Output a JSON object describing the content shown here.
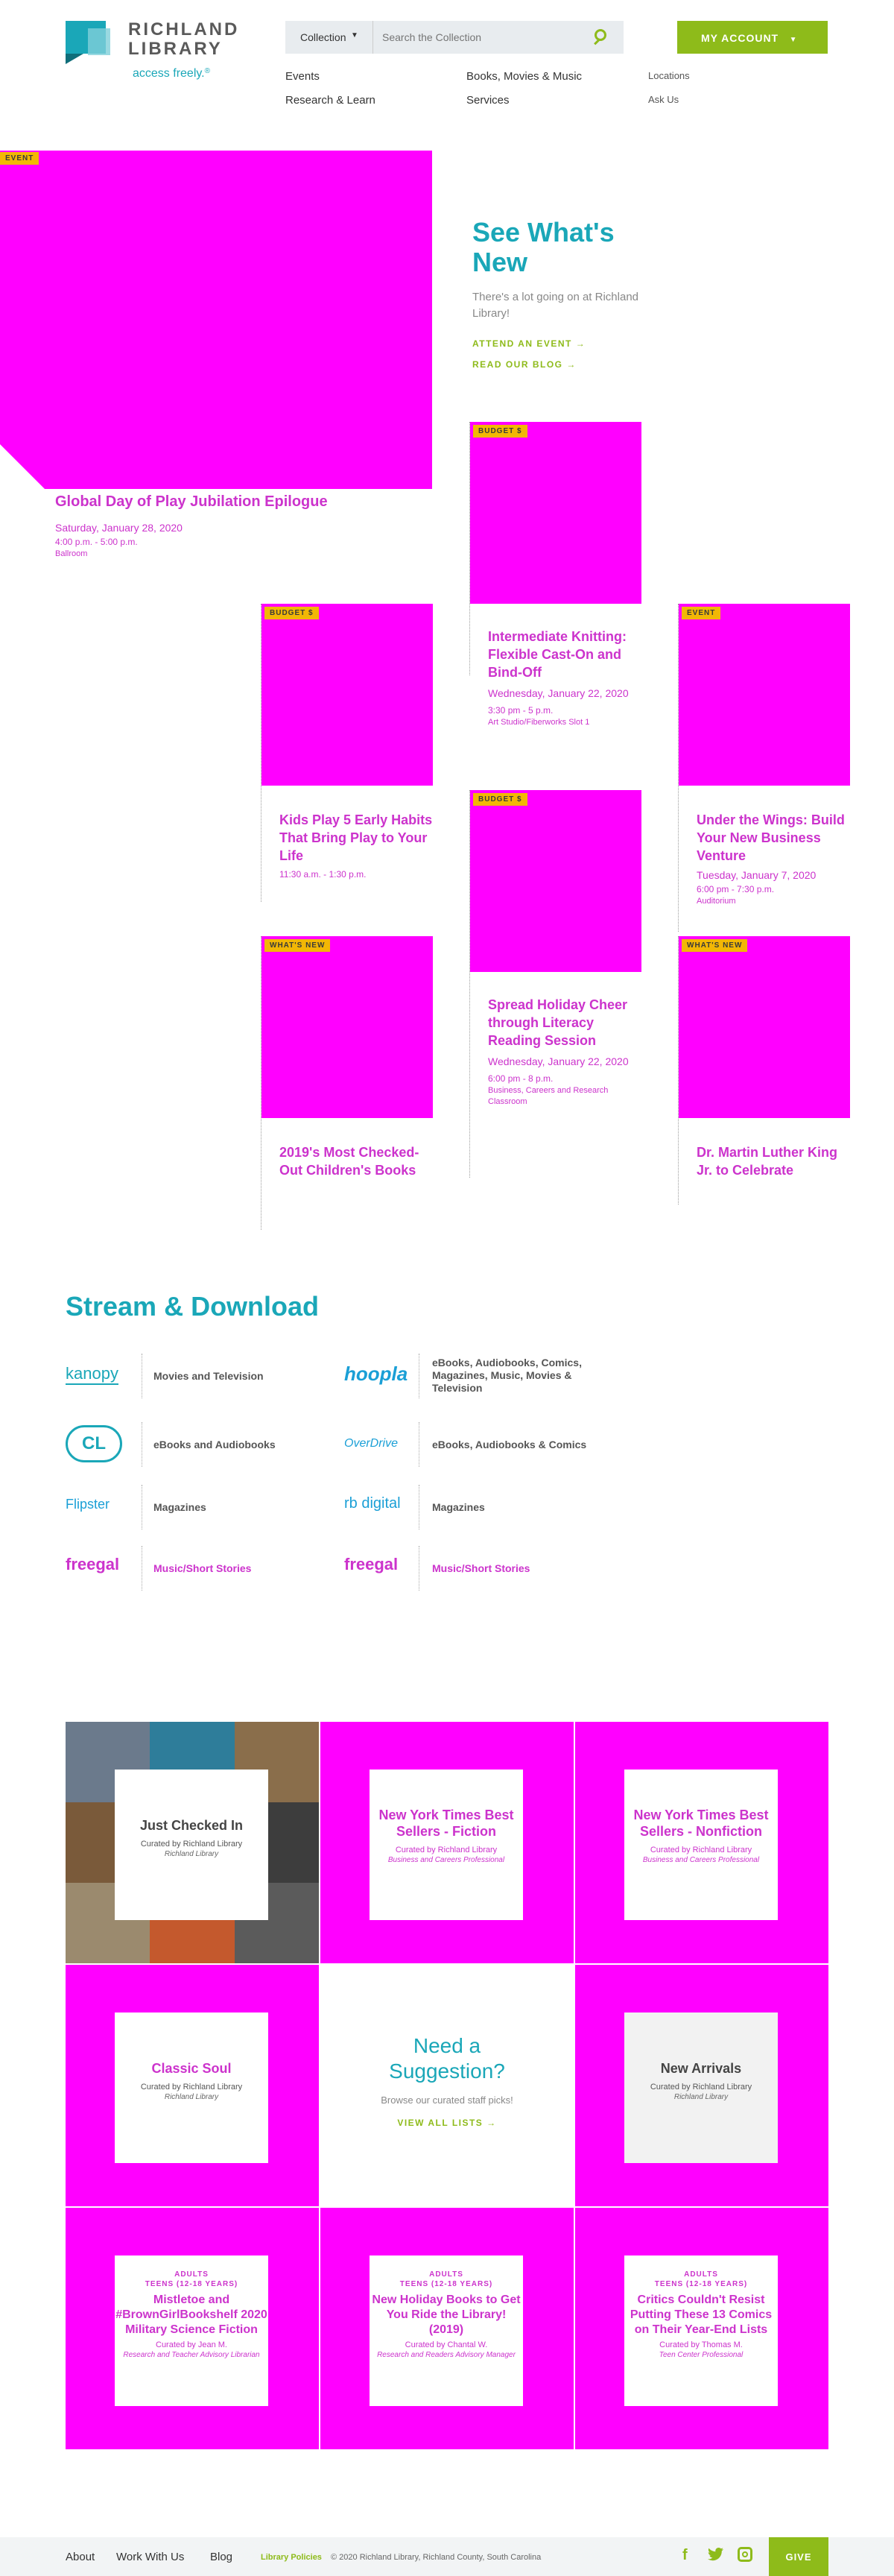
{
  "header": {
    "logo_line1": "RICHLAND",
    "logo_line2": "LIBRARY",
    "tagline": "access freely.",
    "tagline_mark": "®",
    "collection_label": "Collection",
    "search_placeholder": "Search the Collection",
    "account_label": "MY ACCOUNT",
    "nav_main": [
      "Events",
      "Books, Movies & Music",
      "Research & Learn",
      "Services"
    ],
    "nav_side": [
      "Locations",
      "Ask Us"
    ]
  },
  "hero": {
    "tag": "EVENT",
    "title": "See What's New",
    "subtitle": "There's a lot going on at Richland Library!",
    "link1": "ATTEND AN EVENT",
    "link2": "READ OUR BLOG",
    "featured_title": "Global Day of Play Jubilation Epilogue",
    "featured_date": "Saturday, January 28, 2020",
    "featured_time": "4:00 p.m. - 5:00 p.m.",
    "featured_loc": "Ballroom"
  },
  "cards": [
    {
      "tag": "BUDGET $",
      "title": "Intermediate Knitting: Flexible Cast-On and Bind-Off",
      "date": "Wednesday, January 22, 2020",
      "time": "3:30 pm - 5 p.m.",
      "loc": "Art Studio/Fiberworks Slot 1"
    },
    {
      "tag": "BUDGET $",
      "title": "Kids Play 5 Early Habits That Bring Play to Your Life",
      "date": "",
      "time": "11:30 a.m. - 1:30 p.m.",
      "loc": ""
    },
    {
      "tag": "EVENT",
      "title": "Under the Wings: Build Your New Business Venture",
      "date": "Tuesday, January 7, 2020",
      "time": "6:00 pm - 7:30 p.m.",
      "loc": "Auditorium"
    },
    {
      "tag": "BUDGET $",
      "title": "Spread Holiday Cheer through Literacy Reading Session",
      "date": "Wednesday, January 22, 2020",
      "time": "6:00 pm - 8 p.m.",
      "loc": "Business, Careers and Research Classroom"
    },
    {
      "tag": "WHAT'S NEW",
      "title": "2019's Most Checked-Out Children's Books",
      "date": "",
      "time": "",
      "loc": ""
    },
    {
      "tag": "WHAT'S NEW",
      "title": "Dr. Martin Luther King Jr. to Celebrate",
      "date": "",
      "time": "",
      "loc": ""
    }
  ],
  "stream": {
    "heading": "Stream & Download",
    "services": [
      {
        "logo": "kanopy",
        "label": "Movies and Television",
        "color": "#1aa7b8"
      },
      {
        "logo": "hoopla",
        "label": "eBooks, Audiobooks, Comics, Magazines, Music, Movies & Television",
        "color": "#1a9fd6"
      },
      {
        "logo": "CL",
        "label": "eBooks and Audiobooks",
        "color": "#1aa7b8"
      },
      {
        "logo": "OverDrive",
        "label": "eBooks, Audiobooks & Comics",
        "color": "#1a9fd6"
      },
      {
        "logo": "Flipster",
        "label": "Magazines",
        "color": "#1a9fd6"
      },
      {
        "logo": "rb digital",
        "label": "Magazines",
        "color": "#1a9fd6"
      },
      {
        "logo": "freegal",
        "label": "Music/Short Stories",
        "color": "#cc33cc"
      },
      {
        "logo": "freegal",
        "label": "Music/Short Stories",
        "color": "#cc33cc"
      }
    ]
  },
  "lists": {
    "just_checked_in": {
      "title": "Just Checked In",
      "sub": "Curated by Richland Library",
      "sub2": "Richland Library"
    },
    "nyt_fiction": {
      "title": "New York Times Best Sellers - Fiction",
      "sub": "Curated by Richland Library",
      "sub2": "Business and Careers Professional"
    },
    "nyt_nonfiction": {
      "title": "New York Times Best Sellers - Nonfiction",
      "sub": "Curated by Richland Library",
      "sub2": "Business and Careers Professional"
    },
    "music": {
      "title": "Classic Soul",
      "sub": "Curated by Richland Library",
      "sub2": "Richland Library"
    },
    "suggestion": {
      "title": "Need a Suggestion?",
      "sub": "Browse our curated staff picks!",
      "link": "VIEW ALL LISTS"
    },
    "new_arrivals": {
      "title": "New Arrivals",
      "sub": "Curated by Richland Library",
      "sub2": "Richland Library"
    },
    "bottom": [
      {
        "label": "ADULTS",
        "label2": "TEENS (12-18 YEARS)",
        "title": "Mistletoe and #BrownGirlBookshelf 2020 Military Science Fiction",
        "sub": "Curated by Jean M.",
        "sub2": "Research and Teacher Advisory Librarian"
      },
      {
        "label": "ADULTS",
        "label2": "TEENS (12-18 YEARS)",
        "title": "New Holiday Books to Get You Ride the Library! (2019)",
        "sub": "Curated by Chantal W.",
        "sub2": "Research and Readers Advisory Manager"
      },
      {
        "label": "ADULTS",
        "label2": "TEENS (12-18 YEARS)",
        "title": "Critics Couldn't Resist Putting These 13 Comics on Their Year-End Lists",
        "sub": "Curated by Thomas M.",
        "sub2": "Teen Center Professional"
      }
    ]
  },
  "footer": {
    "links": [
      "About",
      "Work With Us",
      "Blog"
    ],
    "policies": "Library Policies",
    "copyright": "© 2020 Richland Library, Richland County, South Carolina",
    "give": "GIVE"
  },
  "colors": {
    "teal": "#1aa7b8",
    "green": "#8ebb1a",
    "magenta": "#ff00ff",
    "gold": "#f2b705"
  }
}
